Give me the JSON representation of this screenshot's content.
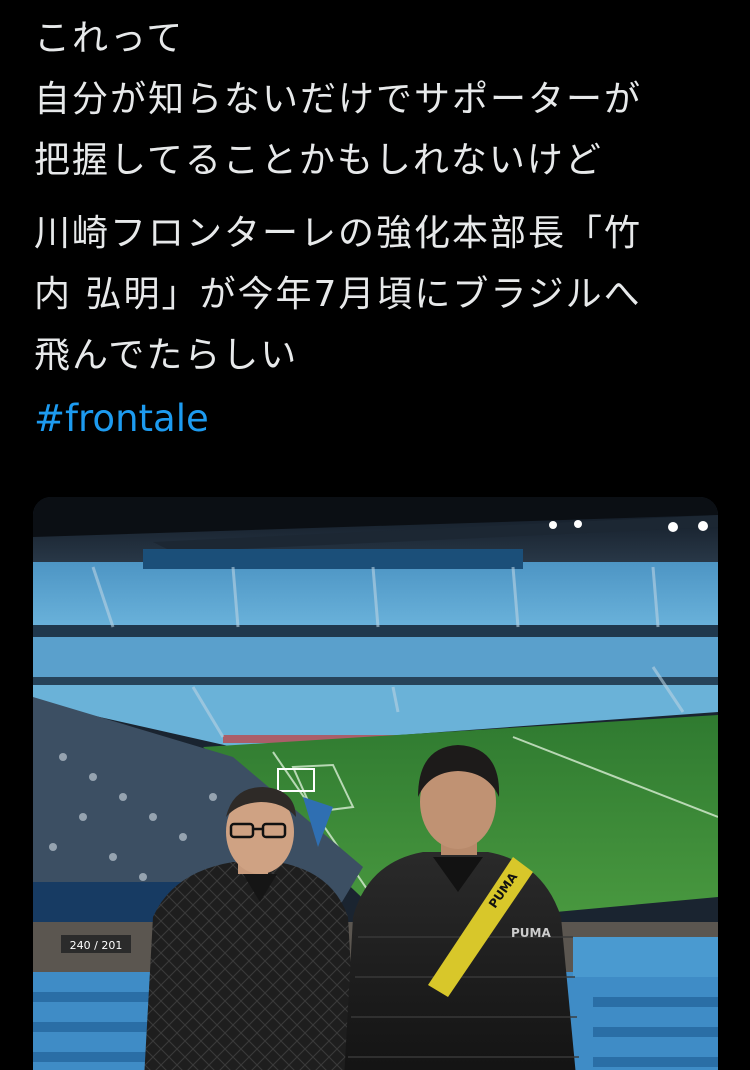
{
  "tweet": {
    "lines_para1": [
      "これって",
      "自分が知らないだけでサポーターが",
      "把握してることかもしれないけど"
    ],
    "lines_para2": [
      "川崎フロンターレの強化本部長「竹",
      "内 弘明」が今年7月頃にブラジルへ",
      "飛んでたらしい"
    ],
    "hashtag": "#frontale"
  },
  "photo": {
    "signs": {
      "aisle_sign": "240 / 201",
      "bag_strap_brand": "PUMA",
      "jacket_logo": "PUMA"
    }
  },
  "colors": {
    "background": "#000000",
    "text": "#e7e9ea",
    "hashtag": "#1d9bf0",
    "pitch": "#3f8a3a",
    "seats": "#5aa6d6"
  }
}
